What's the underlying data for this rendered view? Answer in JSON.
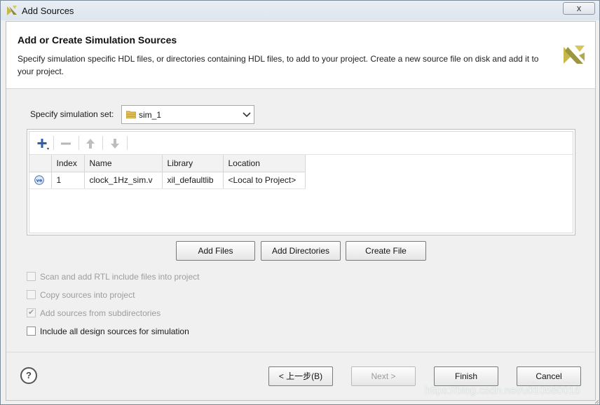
{
  "window": {
    "title": "Add Sources",
    "close_label": "x"
  },
  "header": {
    "title": "Add or Create Simulation Sources",
    "description": "Specify simulation specific HDL files, or directories containing HDL files, to add to your project. Create a new source file on disk and add it to your project."
  },
  "simulation_set": {
    "label": "Specify simulation set:",
    "value": "sim_1"
  },
  "file_table": {
    "columns": [
      "Index",
      "Name",
      "Library",
      "Location"
    ],
    "rows": [
      {
        "icon": "verilog-file-icon",
        "index": "1",
        "name": "clock_1Hz_sim.v",
        "library": "xil_defaultlib",
        "location": "<Local to Project>"
      }
    ]
  },
  "actions": {
    "add_files": "Add Files",
    "add_directories": "Add Directories",
    "create_file": "Create File"
  },
  "options": [
    {
      "label": "Scan and add RTL include files into project",
      "checked": false,
      "enabled": false
    },
    {
      "label": "Copy sources into project",
      "checked": false,
      "enabled": false
    },
    {
      "label": "Add sources from subdirectories",
      "checked": true,
      "enabled": false
    },
    {
      "label": "Include all design sources for simulation",
      "checked": false,
      "enabled": true
    }
  ],
  "footer": {
    "help": "?",
    "back": "< 上一步(B)",
    "next": "Next >",
    "finish": "Finish",
    "cancel": "Cancel"
  },
  "watermark": "https://blog.csdn.net/u010580016",
  "colors": {
    "title_bar": "#dde5ee",
    "accent_blue": "#2b5fa8",
    "xilinx_logo": "#c8b84a"
  }
}
